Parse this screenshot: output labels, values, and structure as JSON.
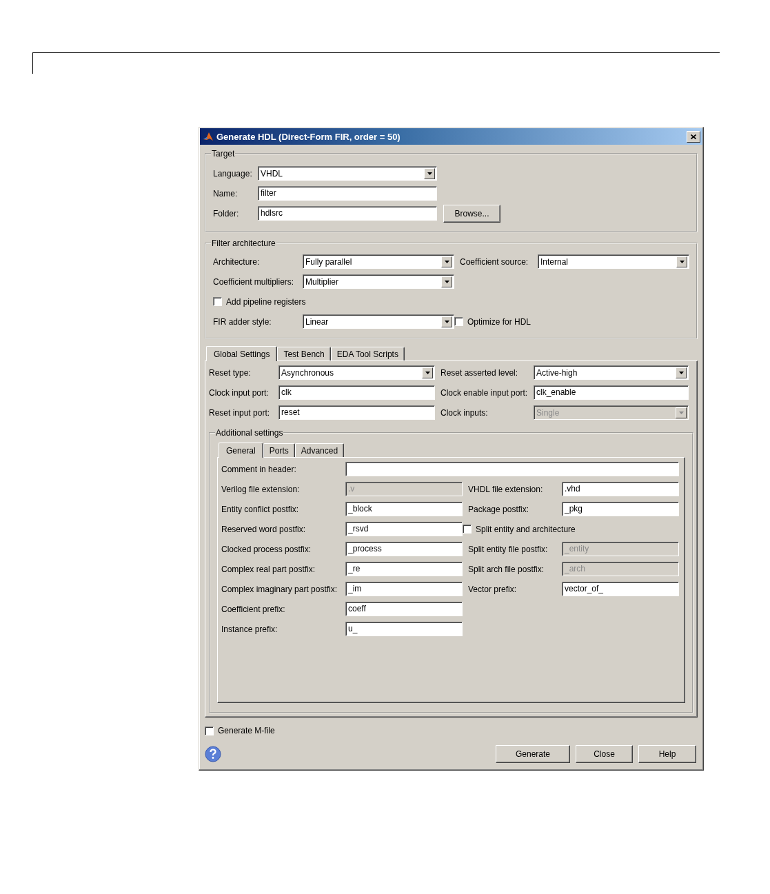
{
  "window": {
    "title": "Generate HDL (Direct-Form FIR, order = 50)"
  },
  "target": {
    "title": "Target",
    "fields": [
      {
        "kind": "dropdown",
        "label": "Language:",
        "value": "VHDL",
        "disabled": false
      },
      {
        "kind": "text",
        "label": "Name:",
        "value": "filter",
        "disabled": false
      },
      {
        "kind": "text",
        "label": "Folder:",
        "value": "hdlsrc",
        "disabled": false
      }
    ],
    "browse_button": "Browse..."
  },
  "filter_architecture": {
    "title": "Filter architecture",
    "rows": [
      [
        {
          "kind": "dropdown",
          "label": "Architecture:",
          "value": "Fully parallel",
          "disabled": false
        },
        {
          "kind": "dropdown",
          "label": "Coefficient source:",
          "value": "Internal",
          "disabled": false
        }
      ],
      [
        {
          "kind": "dropdown",
          "label": "Coefficient multipliers:",
          "value": "Multiplier",
          "disabled": false
        }
      ],
      [
        {
          "kind": "checkbox",
          "label": "Add pipeline registers",
          "checked": false
        }
      ],
      [
        {
          "kind": "dropdown",
          "label": "FIR adder style:",
          "value": "Linear",
          "disabled": false
        },
        {
          "kind": "checkbox",
          "label": "Optimize for HDL",
          "checked": false
        }
      ]
    ]
  },
  "main_tabs": [
    {
      "label": "Global Settings",
      "selected": true
    },
    {
      "label": "Test Bench",
      "selected": false
    },
    {
      "label": "EDA Tool Scripts",
      "selected": false
    }
  ],
  "global_settings": {
    "rows": [
      [
        {
          "kind": "dropdown",
          "label": "Reset type:",
          "value": "Asynchronous",
          "disabled": false
        },
        {
          "kind": "dropdown",
          "label": "Reset asserted level:",
          "value": "Active-high",
          "disabled": false
        }
      ],
      [
        {
          "kind": "text",
          "label": "Clock input port:",
          "value": "clk",
          "disabled": false
        },
        {
          "kind": "text",
          "label": "Clock enable input port:",
          "value": "clk_enable",
          "disabled": false
        }
      ],
      [
        {
          "kind": "text",
          "label": "Reset input port:",
          "value": "reset",
          "disabled": false
        },
        {
          "kind": "dropdown",
          "label": "Clock inputs:",
          "value": "Single",
          "disabled": true
        }
      ]
    ]
  },
  "additional_settings": {
    "title": "Additional settings",
    "tabs": [
      {
        "label": "General",
        "selected": true
      },
      {
        "label": "Ports",
        "selected": false
      },
      {
        "label": "Advanced",
        "selected": false
      }
    ],
    "rows": [
      [
        {
          "kind": "text",
          "label": "Comment in header:",
          "disabled": false
        }
      ],
      [
        {
          "kind": "text",
          "label": "Verilog file extension:",
          "value": ".v",
          "disabled": true
        },
        {
          "kind": "text",
          "label": "VHDL file extension:",
          "value": ".vhd",
          "disabled": false
        }
      ],
      [
        {
          "kind": "text",
          "label": "Entity conflict postfix:",
          "value": "_block",
          "disabled": false
        },
        {
          "kind": "text",
          "label": "Package postfix:",
          "value": "_pkg",
          "disabled": false
        }
      ],
      [
        {
          "kind": "text",
          "label": "Reserved word postfix:",
          "value": "_rsvd",
          "disabled": false
        },
        {
          "kind": "checkbox",
          "label": "Split entity and architecture",
          "checked": false
        }
      ],
      [
        {
          "kind": "text",
          "label": "Clocked process postfix:",
          "value": "_process",
          "disabled": false
        },
        {
          "kind": "text",
          "label": "Split entity file postfix:",
          "value": "_entity",
          "disabled": true
        }
      ],
      [
        {
          "kind": "text",
          "label": "Complex real part postfix:",
          "value": "_re",
          "disabled": false
        },
        {
          "kind": "text",
          "label": "Split arch file postfix:",
          "value": "_arch",
          "disabled": true
        }
      ],
      [
        {
          "kind": "text",
          "label": "Complex imaginary part postfix:",
          "value": "_im",
          "disabled": false
        },
        {
          "kind": "text",
          "label": "Vector prefix:",
          "value": "vector_of_",
          "disabled": false
        }
      ],
      [
        {
          "kind": "text",
          "label": "Coefficient prefix:",
          "value": "coeff",
          "disabled": false
        }
      ],
      [
        {
          "kind": "text",
          "label": "Instance prefix:",
          "value": "u_",
          "disabled": false
        }
      ]
    ]
  },
  "generate_mfile": {
    "label": "Generate M-file",
    "checked": false
  },
  "buttons": [
    "Generate",
    "Close",
    "Help"
  ]
}
